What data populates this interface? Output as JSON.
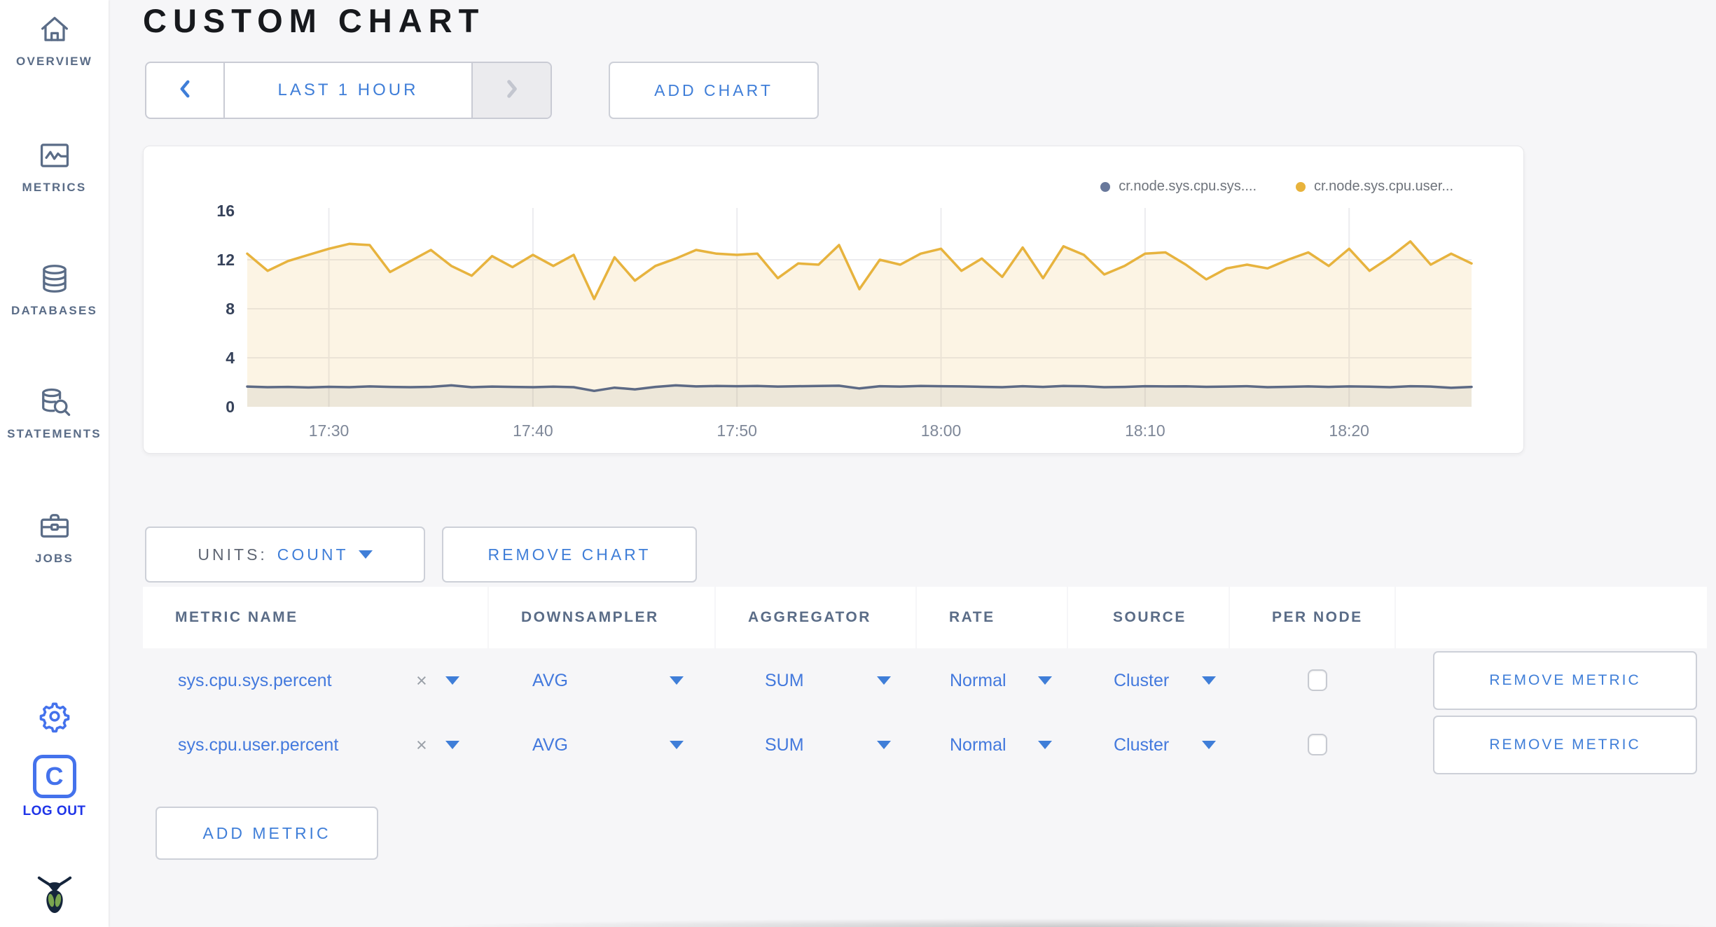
{
  "header": {
    "title": "CUSTOM CHART"
  },
  "sidebar": {
    "items": [
      {
        "label": "OVERVIEW",
        "icon": "home-icon"
      },
      {
        "label": "METRICS",
        "icon": "metrics-icon"
      },
      {
        "label": "DATABASES",
        "icon": "database-icon"
      },
      {
        "label": "STATEMENTS",
        "icon": "statements-icon"
      },
      {
        "label": "JOBS",
        "icon": "jobs-icon"
      }
    ],
    "logout": {
      "label": "LOG OUT",
      "icon_letter": "C"
    }
  },
  "time_selector": {
    "range_label": "LAST 1 HOUR"
  },
  "toolbar": {
    "add_chart_label": "ADD CHART"
  },
  "chart_controls": {
    "units_label": "UNITS:",
    "units_value": "COUNT",
    "remove_chart_label": "REMOVE CHART",
    "add_metric_label": "ADD METRIC"
  },
  "table": {
    "headers": [
      "METRIC NAME",
      "DOWNSAMPLER",
      "AGGREGATOR",
      "RATE",
      "SOURCE",
      "PER NODE"
    ],
    "rows": [
      {
        "metric": "sys.cpu.sys.percent",
        "downsampler": "AVG",
        "aggregator": "SUM",
        "rate": "Normal",
        "source": "Cluster",
        "per_node": false,
        "remove_label": "REMOVE METRIC"
      },
      {
        "metric": "sys.cpu.user.percent",
        "downsampler": "AVG",
        "aggregator": "SUM",
        "rate": "Normal",
        "source": "Cluster",
        "per_node": false,
        "remove_label": "REMOVE METRIC"
      }
    ]
  },
  "colors": {
    "accent_blue": "#3f7ed8",
    "vivid_blue": "#4472ec",
    "sidebar_gray": "#5a6c87",
    "title": "#17191d"
  },
  "chart_data": {
    "type": "line",
    "title": "",
    "xlabel": "",
    "ylabel": "",
    "ylim": [
      0,
      16
    ],
    "y_ticks": [
      0,
      4,
      8,
      12,
      16
    ],
    "x_total_min": 60,
    "x_ticks": [
      {
        "min": 4,
        "label": "17:30"
      },
      {
        "min": 14,
        "label": "17:40"
      },
      {
        "min": 24,
        "label": "17:50"
      },
      {
        "min": 34,
        "label": "18:00"
      },
      {
        "min": 44,
        "label": "18:10"
      },
      {
        "min": 54,
        "label": "18:20"
      }
    ],
    "grid": true,
    "legend_position": "top-right",
    "series": [
      {
        "name": "cr.node.sys.cpu.sys....",
        "color": "#5d6a85",
        "dot_color": "#68789b",
        "fill": "rgba(93,106,133,0.10)",
        "values": [
          1.65,
          1.6,
          1.62,
          1.58,
          1.63,
          1.6,
          1.66,
          1.62,
          1.6,
          1.63,
          1.75,
          1.6,
          1.65,
          1.62,
          1.6,
          1.64,
          1.6,
          1.3,
          1.56,
          1.42,
          1.62,
          1.75,
          1.66,
          1.7,
          1.68,
          1.7,
          1.65,
          1.68,
          1.7,
          1.72,
          1.5,
          1.68,
          1.65,
          1.7,
          1.68,
          1.66,
          1.63,
          1.6,
          1.68,
          1.62,
          1.7,
          1.68,
          1.6,
          1.62,
          1.68,
          1.66,
          1.67,
          1.63,
          1.65,
          1.68,
          1.6,
          1.63,
          1.66,
          1.62,
          1.66,
          1.64,
          1.6,
          1.68,
          1.65,
          1.55,
          1.62
        ]
      },
      {
        "name": "cr.node.sys.cpu.user...",
        "color": "#e7b33e",
        "dot_color": "#e8b33c",
        "fill": "rgba(231,179,62,0.14)",
        "values": [
          12.5,
          11.1,
          11.9,
          12.4,
          12.9,
          13.3,
          13.2,
          11.0,
          11.9,
          12.8,
          11.5,
          10.7,
          12.3,
          11.4,
          12.4,
          11.5,
          12.4,
          8.8,
          12.2,
          10.3,
          11.5,
          12.1,
          12.8,
          12.5,
          12.4,
          12.5,
          10.5,
          11.7,
          11.6,
          13.2,
          9.6,
          12.0,
          11.6,
          12.5,
          12.9,
          11.1,
          12.1,
          10.6,
          13.0,
          10.5,
          13.1,
          12.4,
          10.8,
          11.5,
          12.5,
          12.6,
          11.6,
          10.4,
          11.3,
          11.6,
          11.3,
          12.0,
          12.6,
          11.5,
          12.9,
          11.1,
          12.2,
          13.5,
          11.6,
          12.5,
          11.7
        ]
      }
    ]
  }
}
